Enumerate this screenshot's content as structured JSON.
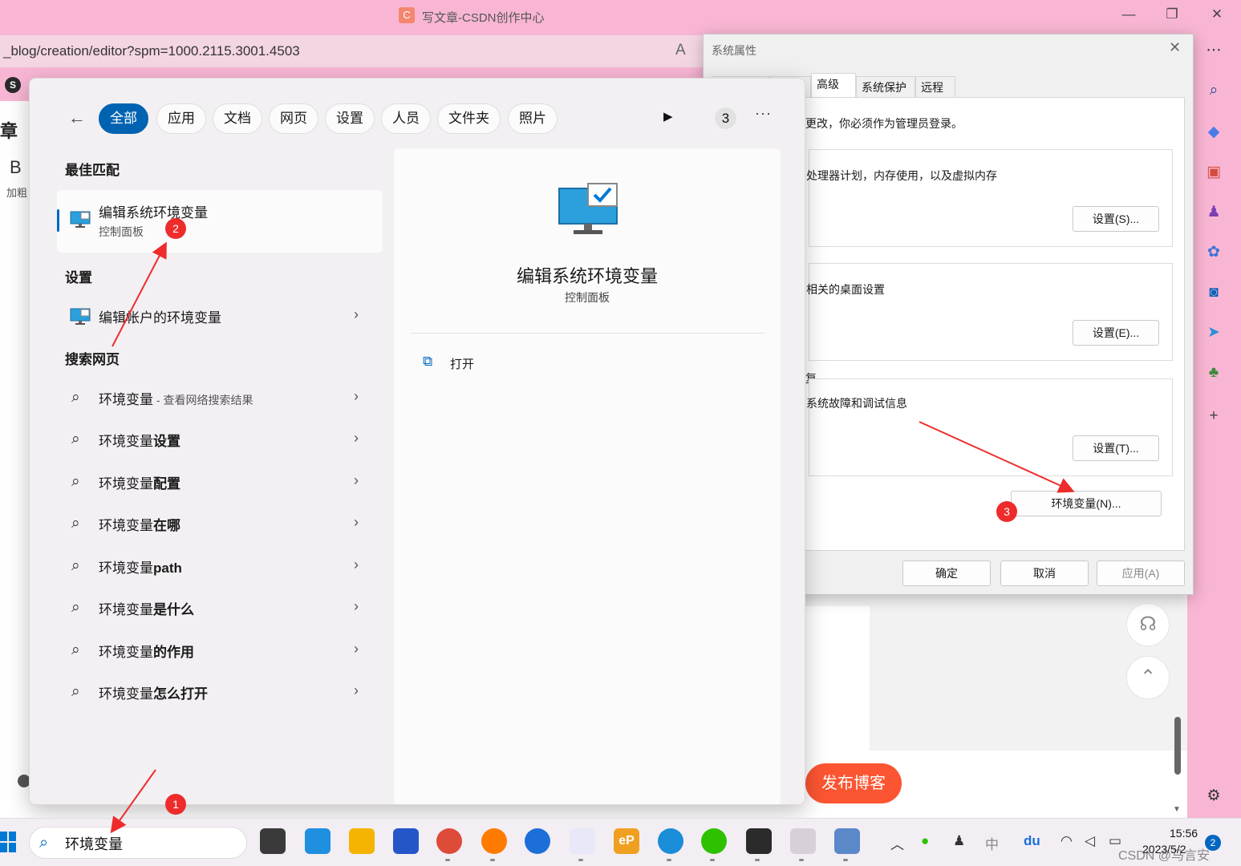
{
  "browser": {
    "tab_title": "写文章-CSDN创作中心",
    "logo_letter": "C",
    "url": "_blog/creation/editor?spm=1000.2115.3001.4503",
    "editor_heading_fragment": "章",
    "bold_letter": "B",
    "bold_caption": "加粗",
    "publish_label": "发布博客",
    "s_logo": "S"
  },
  "system_properties": {
    "title": "系统属性",
    "tabs": [
      "",
      "",
      "高级",
      "系统保护",
      "远程"
    ],
    "notice": "更改，你必须作为管理员登录。",
    "performance_desc": "处理器计划，内存使用，以及虚拟内存",
    "performance_btn": "设置(S)...",
    "profile_desc": "相关的桌面设置",
    "profile_btn": "设置(E)...",
    "startup_title": "复",
    "startup_desc": "系统故障和调试信息",
    "startup_btn": "设置(T)...",
    "env_btn": "环境变量(N)...",
    "ok_btn": "确定",
    "cancel_btn": "取消",
    "apply_btn": "应用(A)"
  },
  "search_panel": {
    "filters": [
      "全部",
      "应用",
      "文档",
      "网页",
      "设置",
      "人员",
      "文件夹",
      "照片"
    ],
    "active_filter": "全部",
    "rewards_count": "3",
    "more": "···",
    "best_match_header": "最佳匹配",
    "best_match": {
      "title": "编辑系统环境变量",
      "subtitle": "控制面板"
    },
    "settings_header": "设置",
    "settings_item": "编辑帐户的环境变量",
    "web_header": "搜索网页",
    "web_results": [
      {
        "prefix": "环境变量",
        "bold": "",
        "sub": " - 查看网络搜索结果"
      },
      {
        "prefix": "环境变量",
        "bold": "设置",
        "sub": ""
      },
      {
        "prefix": "环境变量",
        "bold": "配置",
        "sub": ""
      },
      {
        "prefix": "环境变量",
        "bold": "在哪",
        "sub": ""
      },
      {
        "prefix": "环境变量",
        "bold": "path",
        "sub": ""
      },
      {
        "prefix": "环境变量",
        "bold": "是什么",
        "sub": ""
      },
      {
        "prefix": "环境变量",
        "bold": "的作用",
        "sub": ""
      },
      {
        "prefix": "环境变量",
        "bold": "怎么打开",
        "sub": ""
      }
    ],
    "detail": {
      "title": "编辑系统环境变量",
      "subtitle": "控制面板",
      "open_label": "打开"
    }
  },
  "taskbar": {
    "search_value": "环境变量",
    "time": "15:56",
    "date": "2023/5/2",
    "notification_count": "2",
    "ime": "中",
    "watermark": "CSDN @马言安"
  },
  "annotations": [
    "1",
    "2",
    "3"
  ],
  "colors": {
    "accent": "#0063b1",
    "publish": "#fc5531",
    "marker": "#ee2c2c",
    "desktop": "#f9b6d4"
  }
}
